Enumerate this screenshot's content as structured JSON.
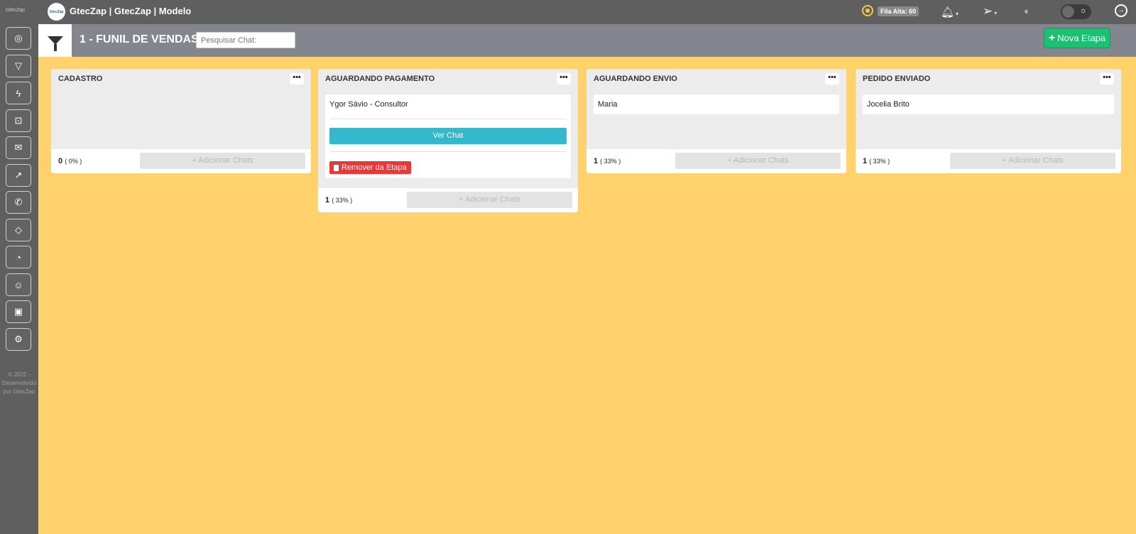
{
  "app": {
    "side_logo": "GtecZap",
    "brand_logo": "GtecZap",
    "title": "GtecZap | GtecZap | Modelo",
    "fila_badge": "Fila Alta: 60"
  },
  "sidebar": {
    "items": [
      {
        "name": "chat",
        "icon": "chat-icon",
        "glyph": "◎"
      },
      {
        "name": "funnel",
        "icon": "funnel-icon",
        "glyph": "▽"
      },
      {
        "name": "lightning",
        "icon": "lightning-icon",
        "glyph": "ϟ"
      },
      {
        "name": "robot",
        "icon": "robot-icon",
        "glyph": "⊡"
      },
      {
        "name": "mail",
        "icon": "mail-icon",
        "glyph": "✉"
      },
      {
        "name": "chart",
        "icon": "chart-icon",
        "glyph": "↗"
      },
      {
        "name": "phone",
        "icon": "phone-icon",
        "glyph": "✆"
      },
      {
        "name": "tag",
        "icon": "tag-icon",
        "glyph": "◇"
      },
      {
        "name": "gauge",
        "icon": "gauge-icon",
        "glyph": "◔"
      },
      {
        "name": "user",
        "icon": "user-icon",
        "glyph": "☺"
      },
      {
        "name": "image",
        "icon": "image-icon",
        "glyph": "▣"
      },
      {
        "name": "settings",
        "icon": "gear-icon",
        "glyph": "⚙"
      }
    ],
    "footer_line1": "© 2022 -",
    "footer_line2": "Desenvolvido",
    "footer_line3": "por GtecZap"
  },
  "header": {
    "title": "1 - FUNIL DE VENDAS",
    "search_placeholder": "Pesquisar Chat:",
    "new_stage_plus": "+",
    "new_stage_label": "Nova Etapa"
  },
  "columns": [
    {
      "title": "CADASTRO",
      "more": "•••",
      "count": "0",
      "pct": "( 0% )",
      "add_label": "+ Adicionar Chats"
    },
    {
      "title": "AGUARDANDO PAGAMENTO",
      "more": "•••",
      "card_name": "Ygor Sávio - Consultor",
      "ver_chat": "Ver Chat",
      "remove": "Remover da Etapa",
      "count": "1",
      "pct": "( 33% )",
      "add_label": "+ Adicionar Chats"
    },
    {
      "title": "AGUARDANDO ENVIO",
      "more": "•••",
      "card_name": "Maria",
      "count": "1",
      "pct": "( 33% )",
      "add_label": "+ Adicionar Chats"
    },
    {
      "title": "PEDIDO ENVIADO",
      "more": "•••",
      "card_name": "Jocelia Brito",
      "count": "1",
      "pct": "( 33% )",
      "add_label": "+ Adicionar Chats"
    }
  ],
  "colors": {
    "board_bg": "#FFD26E",
    "topbar": "#5f5f5f",
    "header": "#83868f",
    "accent_green": "#1dbf73",
    "ver_chat": "#35b8cc",
    "remove_red": "#e53a3a"
  }
}
